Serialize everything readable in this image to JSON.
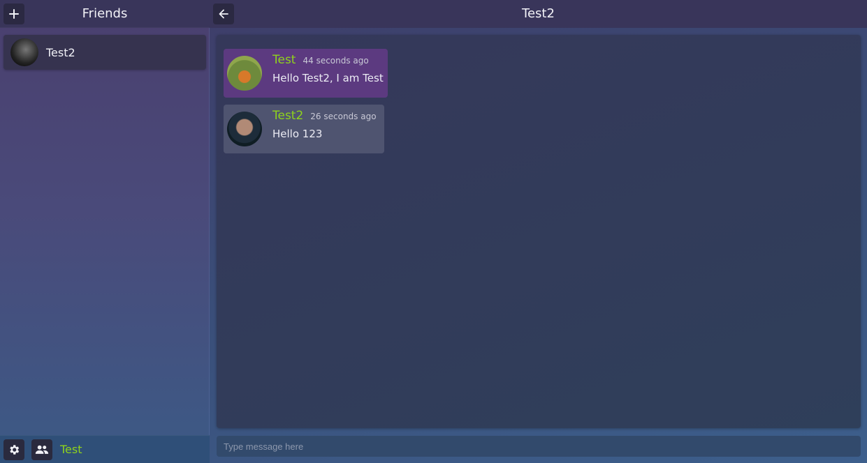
{
  "sidebar": {
    "title": "Friends",
    "add_icon": "plus-icon",
    "friends": [
      {
        "name": "Test2",
        "avatar": "avatar-photo"
      }
    ],
    "footer": {
      "settings_icon": "gear-icon",
      "friends_icon": "people-icon",
      "current_user": "Test"
    }
  },
  "chat": {
    "title": "Test2",
    "back_icon": "arrow-left-icon",
    "messages": [
      {
        "user": "Test",
        "time": "44 seconds ago",
        "text": "Hello Test2, I am Test"
      },
      {
        "user": "Test2",
        "time": "26 seconds ago",
        "text": "Hello 123"
      }
    ],
    "input_placeholder": "Type message here"
  },
  "colors": {
    "accent_username": "#8fd31c",
    "own_message_bg": "#5c3a80",
    "other_message_bg": "#4f5470"
  }
}
